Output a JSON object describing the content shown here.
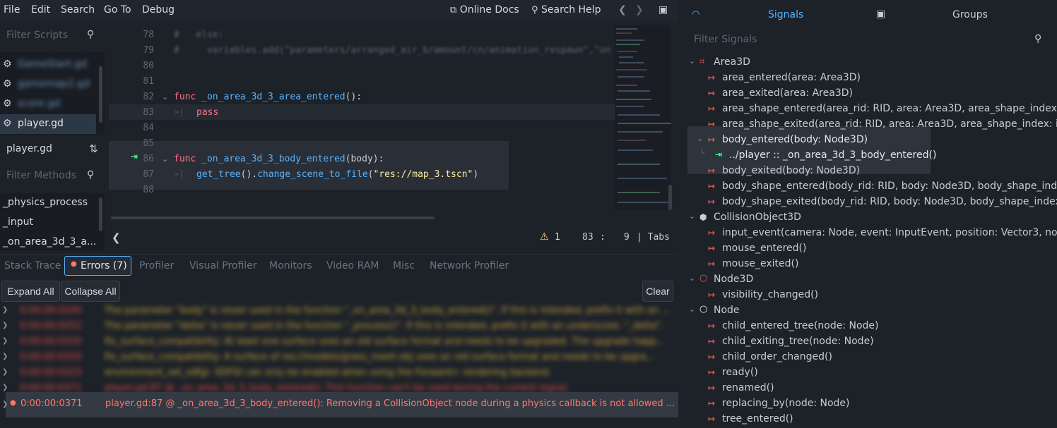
{
  "menu": [
    "File",
    "Edit",
    "Search",
    "Go To",
    "Debug"
  ],
  "toolbar": {
    "online_docs": "Online Docs",
    "search_help": "Search Help",
    "nav_back": "❮",
    "nav_fwd": "❯"
  },
  "scripts": {
    "filter_placeholder": "Filter Scripts",
    "items": [
      {
        "name": "GameStart.gd",
        "blurred": true
      },
      {
        "name": "gamemap2.gd",
        "blurred": true
      },
      {
        "name": "score.gd",
        "blurred": true
      },
      {
        "name": "player.gd",
        "blurred": false
      }
    ],
    "current": "player.gd"
  },
  "methods": {
    "filter_placeholder": "Filter Methods",
    "items": [
      "_physics_process",
      "_input",
      "_on_area_3d_3_a..."
    ]
  },
  "editor": {
    "lines": [
      {
        "num": "78",
        "text": "#   else:"
      },
      {
        "num": "79",
        "text": "#     variables.add(\"parameters/arranged_air_b/amount/cn/animation_respawn\",\"on"
      },
      {
        "num": "80",
        "text": ""
      },
      {
        "num": "81",
        "text": ""
      },
      {
        "num": "82",
        "text": "func _on_area_3d_3_area_entered():"
      },
      {
        "num": "83",
        "text": "pass"
      },
      {
        "num": "84",
        "text": ""
      },
      {
        "num": "85",
        "text": ""
      },
      {
        "num": "86",
        "text": "func _on_area_3d_3_body_entered(body):"
      },
      {
        "num": "87",
        "text": "get_tree().change_scene_to_file(\"res://map_3.tscn\")"
      },
      {
        "num": "88",
        "text": ""
      }
    ]
  },
  "status": {
    "warnings": "1",
    "line": "83",
    "sep": ":",
    "col": "9",
    "indent": "| Tabs"
  },
  "debugger": {
    "tabs": [
      "Stack Trace",
      "Errors (7)",
      "Profiler",
      "Visual Profiler",
      "Monitors",
      "Video RAM",
      "Misc",
      "Network Profiler"
    ],
    "expand_all": "Expand All",
    "collapse_all": "Collapse All",
    "clear": "Clear",
    "errors": [
      {
        "time": "0:00:00:0240",
        "msg": "The parameter \"body\" is never used in the function \"_on_area_3d_3_body_entered()\". If this is intended, prefix it with an ..."
      },
      {
        "time": "0:00:00:0252",
        "msg": "The parameter \"delta\" is never used in the function \"_process()\". If this is intended, prefix it with an underscore: \"_delta\"."
      },
      {
        "time": "0:00:00:0320",
        "msg": "fix_surface_compatibility: At least one surface uses an old surface format and needs to be upgraded. The upgrade happ..."
      },
      {
        "time": "0:00:00:0320",
        "msg": "fix_surface_compatibility: A surface of res://models/grass_mesh.obj uses an old surface format and needs to be upgra..."
      },
      {
        "time": "0:00:00:0323",
        "msg": "environment_set_sdfgi: SDFGI can only be enabled when using the Forward+ rendering backend."
      },
      {
        "time": "0:00:00:0371",
        "msg": "player.gd:87 @ _on_area_3d_3_body_entered(): This function can't be used during the current signal."
      }
    ],
    "selected": {
      "time": "0:00:00:0371",
      "msg": "player.gd:87 @ _on_area_3d_3_body_entered(): Removing a CollisionObject node during a physics callback is not allowed ..."
    }
  },
  "signals_panel": {
    "tab_signals": "Signals",
    "tab_groups": "Groups",
    "filter_placeholder": "Filter Signals",
    "rows": [
      {
        "type": "class",
        "text": "Area3D",
        "icon": "area3d-icon"
      },
      {
        "type": "signal",
        "text": "area_entered(area: Area3D)"
      },
      {
        "type": "signal",
        "text": "area_exited(area: Area3D)"
      },
      {
        "type": "signal",
        "text": "area_shape_entered(area_rid: RID, area: Area3D, area_shape_index: i..."
      },
      {
        "type": "signal",
        "text": "area_shape_exited(area_rid: RID, area: Area3D, area_shape_index: int,..."
      },
      {
        "type": "signal-connected",
        "text": "body_entered(body: Node3D)"
      },
      {
        "type": "connection",
        "text": "../player :: _on_area_3d_3_body_entered()"
      },
      {
        "type": "signal",
        "text": "body_exited(body: Node3D)"
      },
      {
        "type": "signal",
        "text": "body_shape_entered(body_rid: RID, body: Node3D, body_shape_inde..."
      },
      {
        "type": "signal",
        "text": "body_shape_exited(body_rid: RID, body: Node3D, body_shape_index: ..."
      },
      {
        "type": "class",
        "text": "CollisionObject3D",
        "icon": "collision-object-icon"
      },
      {
        "type": "signal",
        "text": "input_event(camera: Node, event: InputEvent, position: Vector3, nor..."
      },
      {
        "type": "signal",
        "text": "mouse_entered()"
      },
      {
        "type": "signal",
        "text": "mouse_exited()"
      },
      {
        "type": "class",
        "text": "Node3D",
        "icon": "node3d-icon"
      },
      {
        "type": "signal",
        "text": "visibility_changed()"
      },
      {
        "type": "class",
        "text": "Node",
        "icon": "node-icon"
      },
      {
        "type": "signal",
        "text": "child_entered_tree(node: Node)"
      },
      {
        "type": "signal",
        "text": "child_exiting_tree(node: Node)"
      },
      {
        "type": "signal",
        "text": "child_order_changed()"
      },
      {
        "type": "signal",
        "text": "ready()"
      },
      {
        "type": "signal",
        "text": "renamed()"
      },
      {
        "type": "signal",
        "text": "replacing_by(node: Node)"
      },
      {
        "type": "signal",
        "text": "tree_entered()"
      }
    ]
  },
  "colors": {
    "accent": "#57b3ff",
    "error": "#ff786b",
    "signal": "#e8594c",
    "connection": "#45ff8b",
    "warning": "#ffdd65"
  }
}
